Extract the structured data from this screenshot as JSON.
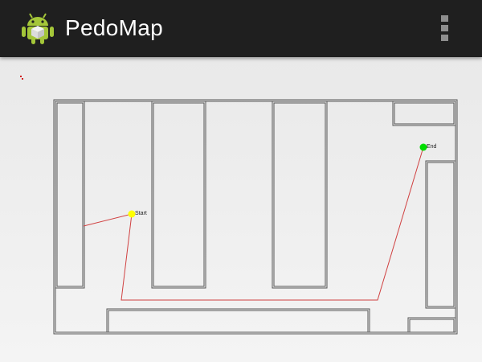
{
  "app": {
    "title": "PedoMap",
    "icon": "android-robot-icon",
    "overflow_icon": "overflow-menu-icon"
  },
  "map": {
    "start_label": "Start",
    "end_label": "End",
    "start_color": "#ffff00",
    "end_color": "#00dd00",
    "route_color": "#d04040",
    "wall_color": "#555555"
  }
}
